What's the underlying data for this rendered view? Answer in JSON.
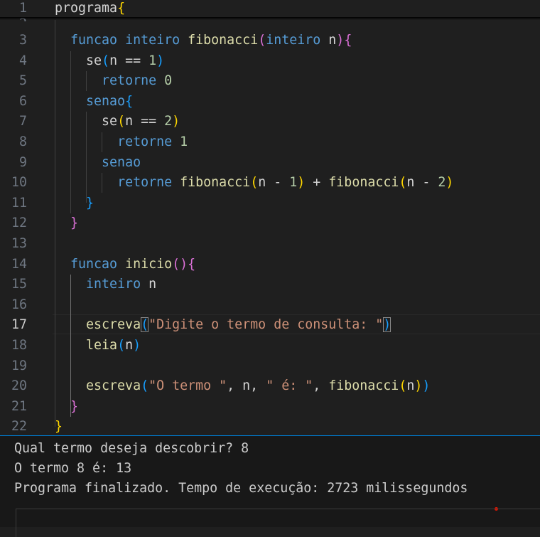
{
  "editor": {
    "active_line": 17,
    "line_numbers": [
      "1",
      "2",
      "3",
      "4",
      "5",
      "6",
      "7",
      "8",
      "9",
      "10",
      "11",
      "12",
      "13",
      "14",
      "15",
      "16",
      "17",
      "18",
      "19",
      "20",
      "21",
      "22"
    ],
    "lines": [
      [
        {
          "t": "programa",
          "c": "id"
        },
        {
          "t": "{",
          "c": "b1"
        }
      ],
      [],
      [
        {
          "t": "  "
        },
        {
          "t": "funcao",
          "c": "kw"
        },
        {
          "t": " "
        },
        {
          "t": "inteiro",
          "c": "kw"
        },
        {
          "t": " "
        },
        {
          "t": "fibonacci",
          "c": "fn"
        },
        {
          "t": "(",
          "c": "b2"
        },
        {
          "t": "inteiro",
          "c": "kw"
        },
        {
          "t": " "
        },
        {
          "t": "n",
          "c": "id"
        },
        {
          "t": ")",
          "c": "b2"
        },
        {
          "t": "{",
          "c": "b2"
        }
      ],
      [
        {
          "t": "    "
        },
        {
          "t": "se",
          "c": "id"
        },
        {
          "t": "(",
          "c": "b3"
        },
        {
          "t": "n == ",
          "c": "id"
        },
        {
          "t": "1",
          "c": "num"
        },
        {
          "t": ")",
          "c": "b3"
        }
      ],
      [
        {
          "t": "      "
        },
        {
          "t": "retorne",
          "c": "kw"
        },
        {
          "t": " "
        },
        {
          "t": "0",
          "c": "num"
        }
      ],
      [
        {
          "t": "    "
        },
        {
          "t": "senao",
          "c": "kw"
        },
        {
          "t": "{",
          "c": "b3"
        }
      ],
      [
        {
          "t": "      "
        },
        {
          "t": "se",
          "c": "id"
        },
        {
          "t": "(",
          "c": "b1"
        },
        {
          "t": "n == ",
          "c": "id"
        },
        {
          "t": "2",
          "c": "num"
        },
        {
          "t": ")",
          "c": "b1"
        }
      ],
      [
        {
          "t": "        "
        },
        {
          "t": "retorne",
          "c": "kw"
        },
        {
          "t": " "
        },
        {
          "t": "1",
          "c": "num"
        }
      ],
      [
        {
          "t": "      "
        },
        {
          "t": "senao",
          "c": "kw"
        }
      ],
      [
        {
          "t": "        "
        },
        {
          "t": "retorne",
          "c": "kw"
        },
        {
          "t": " "
        },
        {
          "t": "fibonacci",
          "c": "fn"
        },
        {
          "t": "(",
          "c": "b1"
        },
        {
          "t": "n - ",
          "c": "id"
        },
        {
          "t": "1",
          "c": "num"
        },
        {
          "t": ")",
          "c": "b1"
        },
        {
          "t": " + ",
          "c": "id"
        },
        {
          "t": "fibonacci",
          "c": "fn"
        },
        {
          "t": "(",
          "c": "b1"
        },
        {
          "t": "n - ",
          "c": "id"
        },
        {
          "t": "2",
          "c": "num"
        },
        {
          "t": ")",
          "c": "b1"
        }
      ],
      [
        {
          "t": "    "
        },
        {
          "t": "}",
          "c": "b3"
        }
      ],
      [
        {
          "t": "  "
        },
        {
          "t": "}",
          "c": "b2"
        }
      ],
      [],
      [
        {
          "t": "  "
        },
        {
          "t": "funcao",
          "c": "kw"
        },
        {
          "t": " "
        },
        {
          "t": "inicio",
          "c": "fn"
        },
        {
          "t": "(",
          "c": "b2"
        },
        {
          "t": ")",
          "c": "b2"
        },
        {
          "t": "{",
          "c": "b2"
        }
      ],
      [
        {
          "t": "    "
        },
        {
          "t": "inteiro",
          "c": "kw"
        },
        {
          "t": " "
        },
        {
          "t": "n",
          "c": "id"
        }
      ],
      [],
      [
        {
          "t": "    "
        },
        {
          "t": "escreva",
          "c": "fn"
        },
        {
          "t": "(",
          "c": "b3",
          "m": true
        },
        {
          "t": "\"Digite o termo de consulta: \"",
          "c": "str"
        },
        {
          "t": ")",
          "c": "b3",
          "m": true
        }
      ],
      [
        {
          "t": "    "
        },
        {
          "t": "leia",
          "c": "fn"
        },
        {
          "t": "(",
          "c": "b3"
        },
        {
          "t": "n",
          "c": "id"
        },
        {
          "t": ")",
          "c": "b3"
        }
      ],
      [],
      [
        {
          "t": "    "
        },
        {
          "t": "escreva",
          "c": "fn"
        },
        {
          "t": "(",
          "c": "b3"
        },
        {
          "t": "\"O termo \"",
          "c": "str"
        },
        {
          "t": ", n, ",
          "c": "id"
        },
        {
          "t": "\" é: \"",
          "c": "str"
        },
        {
          "t": ", ",
          "c": "id"
        },
        {
          "t": "fibonacci",
          "c": "fn"
        },
        {
          "t": "(",
          "c": "b1"
        },
        {
          "t": "n",
          "c": "id"
        },
        {
          "t": ")",
          "c": "b1"
        },
        {
          "t": ")",
          "c": "b3"
        }
      ],
      [
        {
          "t": "  "
        },
        {
          "t": "}",
          "c": "b2"
        }
      ],
      [
        {
          "t": "}",
          "c": "b1"
        }
      ]
    ]
  },
  "terminal": {
    "lines": [
      "Qual termo deseja descobrir? 8",
      "O termo 8 é: 13",
      "Programa finalizado. Tempo de execução: 2723 milissegundos"
    ],
    "input_value": ""
  },
  "colors": {
    "keyword": "#569cd6",
    "function": "#dcdcaa",
    "number": "#b5cea8",
    "string": "#ce9178",
    "bracket_level1": "#ffd700",
    "bracket_level2": "#da70d6",
    "bracket_level3": "#179fff",
    "panel_border": "#007acc"
  }
}
